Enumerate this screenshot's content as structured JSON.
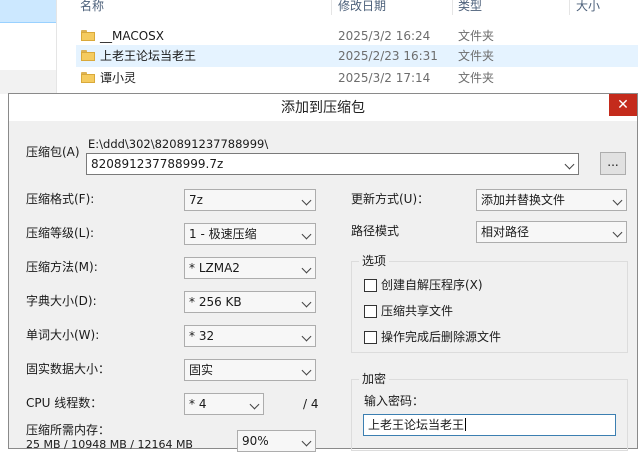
{
  "explorer": {
    "columns": [
      "名称",
      "修改日期",
      "类型",
      "大小"
    ],
    "files": [
      {
        "name": "__MACOSX",
        "date": "2025/3/2 16:24",
        "type": "文件夹"
      },
      {
        "name": "上老王论坛当老王",
        "date": "2025/2/23 16:31",
        "type": "文件夹"
      },
      {
        "name": "谭小灵",
        "date": "2025/3/2 17:14",
        "type": "文件夹"
      }
    ]
  },
  "dialog": {
    "title": "添加到压缩包",
    "close_glyph": "✕",
    "archive": {
      "label": "压缩包(A)",
      "path": "E:\\ddd\\302\\820891237788999\\",
      "value": "820891237788999.7z",
      "browse_label": "..."
    },
    "left": {
      "format": {
        "label": "压缩格式(F):",
        "value": "7z"
      },
      "level": {
        "label": "压缩等级(L):",
        "value": "1 - 极速压缩"
      },
      "method": {
        "label": "压缩方法(M):",
        "value": "* LZMA2"
      },
      "dict": {
        "label": "字典大小(D):",
        "value": "* 256 KB"
      },
      "word": {
        "label": "单词大小(W):",
        "value": "* 32"
      },
      "solid": {
        "label": "固实数据大小：",
        "value": "固实"
      },
      "threads": {
        "label": "CPU 线程数：",
        "value": "* 4",
        "total": "/ 4"
      },
      "memory": {
        "label": "压缩所需内存：",
        "detail": "25 MB / 10948 MB / 12164 MB",
        "value": "90%"
      }
    },
    "right": {
      "update": {
        "label": "更新方式(U)：",
        "value": "添加并替换文件"
      },
      "pathmode": {
        "label": "路径模式",
        "value": "相对路径"
      },
      "options": {
        "title": "选项",
        "items": [
          "创建自解压程序(X)",
          "压缩共享文件",
          "操作完成后删除源文件"
        ]
      },
      "encryption": {
        "title": "加密",
        "password_label": "输入密码：",
        "password_value": "上老王论坛当老王"
      }
    }
  }
}
